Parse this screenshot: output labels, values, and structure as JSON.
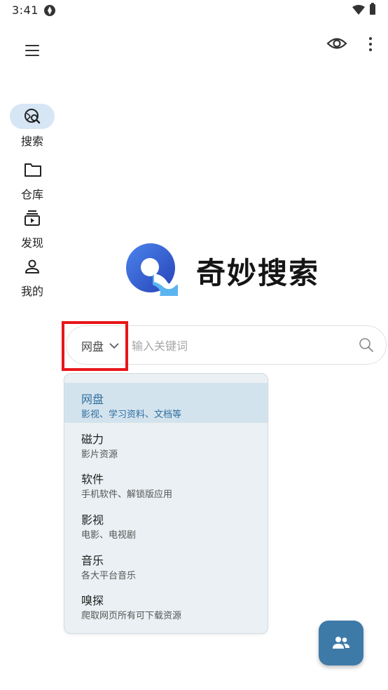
{
  "status_bar": {
    "time": "3:41"
  },
  "app": {
    "name": "奇妙搜索",
    "accent_color": "#3e7aa8",
    "logo_colors": [
      "#3b6ed8",
      "#2a4fbd",
      "#5bb4f0"
    ]
  },
  "header": {
    "menu_icon": "hamburger-menu-icon",
    "eye_icon": "eye-icon",
    "more_icon": "more-vert-icon"
  },
  "nav": {
    "items": [
      {
        "label": "搜索",
        "icon": "search-globe-icon",
        "active": true
      },
      {
        "label": "仓库",
        "icon": "folder-icon",
        "active": false
      },
      {
        "label": "发现",
        "icon": "video-library-icon",
        "active": false
      },
      {
        "label": "我的",
        "icon": "person-icon",
        "active": false
      }
    ]
  },
  "search": {
    "category": "网盘",
    "placeholder": "输入关键词"
  },
  "dropdown": {
    "options": [
      {
        "title": "网盘",
        "desc": "影视、学习资料、文档等",
        "selected": true
      },
      {
        "title": "磁力",
        "desc": "影片资源"
      },
      {
        "title": "软件",
        "desc": "手机软件、解锁版应用"
      },
      {
        "title": "影视",
        "desc": "电影、电视剧"
      },
      {
        "title": "音乐",
        "desc": "各大平台音乐"
      },
      {
        "title": "嗅探",
        "desc": "爬取网页所有可下载资源"
      }
    ]
  },
  "fab": {
    "icon": "group-icon"
  }
}
